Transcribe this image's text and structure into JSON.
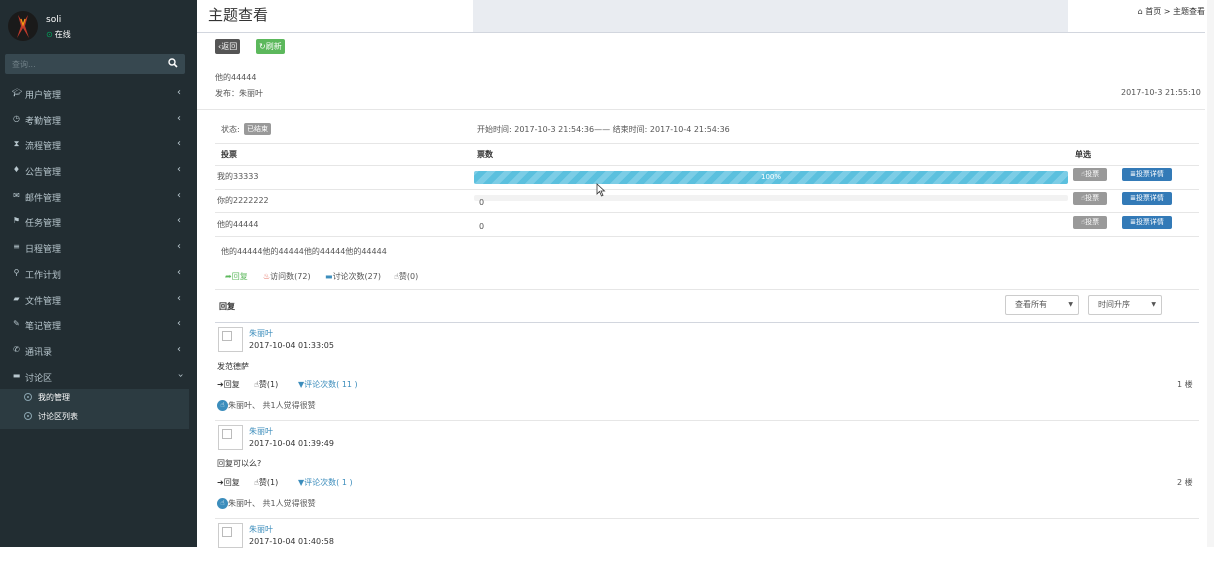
{
  "sidebar": {
    "user": {
      "name": "soli",
      "status": "在线"
    },
    "search_placeholder": "查询...",
    "items": [
      {
        "label": "用户管理",
        "icon": "graduation-cap-icon"
      },
      {
        "label": "考勤管理",
        "icon": "clock-icon"
      },
      {
        "label": "流程管理",
        "icon": "hourglass-icon"
      },
      {
        "label": "公告管理",
        "icon": "bell-icon"
      },
      {
        "label": "邮件管理",
        "icon": "envelope-icon"
      },
      {
        "label": "任务管理",
        "icon": "flag-icon"
      },
      {
        "label": "日程管理",
        "icon": "list-icon"
      },
      {
        "label": "工作计划",
        "icon": "tasks-icon"
      },
      {
        "label": "文件管理",
        "icon": "folder-open-icon"
      },
      {
        "label": "笔记管理",
        "icon": "edit-icon"
      },
      {
        "label": "通讯录",
        "icon": "phone-icon"
      },
      {
        "label": "讨论区",
        "icon": "comment-icon"
      }
    ],
    "subitems": [
      {
        "label": "我的管理"
      },
      {
        "label": "讨论区列表"
      }
    ]
  },
  "header": {
    "title": "主题查看",
    "breadcrumb_home": "首页",
    "breadcrumb_sep": ">",
    "breadcrumb_current": "主题查看"
  },
  "toolbar": {
    "back": "返回",
    "refresh": "刷新"
  },
  "topic": {
    "title": "他的44444",
    "publisher": "发布：朱丽叶",
    "time": "2017-10-3 21:55:10"
  },
  "vote": {
    "status_label": "状态:",
    "status_value": "已结束",
    "period": "开始时间: 2017-10-3 21:54:36—— 结束时间: 2017-10-4 21:54:36",
    "col_option": "投票",
    "col_count": "票数",
    "col_type": "单选",
    "vote_button": "投票",
    "detail_button": "投票详情",
    "rows": [
      {
        "option": "我的33333",
        "percent": 100,
        "label": "100%"
      },
      {
        "option": "你的2222222",
        "percent": 0,
        "label": "0"
      },
      {
        "option": "他的44444",
        "percent": 0,
        "label": "0"
      }
    ]
  },
  "content": "他的44444他的44444他的44444他的44444",
  "actions": {
    "reply": "回复",
    "views": "访问数(72)",
    "discussions": "讨论次数(27)",
    "likes": "赞(0)"
  },
  "replies_section": {
    "title": "回复",
    "filter": "查看所有",
    "sort": "时间升序",
    "items": [
      {
        "author": "朱丽叶",
        "time": "2017-10-04 01:33:05",
        "text": "发范德萨",
        "reply": "回复",
        "like": "赞(1)",
        "comments": "评论次数( 11 )",
        "floor": "1 楼",
        "liked_by": "朱丽叶、 共1人觉得很赞"
      },
      {
        "author": "朱丽叶",
        "time": "2017-10-04 01:39:49",
        "text": "回复可以么?",
        "reply": "回复",
        "like": "赞(1)",
        "comments": "评论次数( 1 )",
        "floor": "2 楼",
        "liked_by": "朱丽叶、 共1人觉得很赞"
      },
      {
        "author": "朱丽叶",
        "time": "2017-10-04 01:40:58"
      }
    ]
  },
  "colors": {
    "sidebar_bg": "#222d32",
    "accent": "#3c8dbc",
    "success": "#5cb85c",
    "progress": "#5bc0de"
  }
}
